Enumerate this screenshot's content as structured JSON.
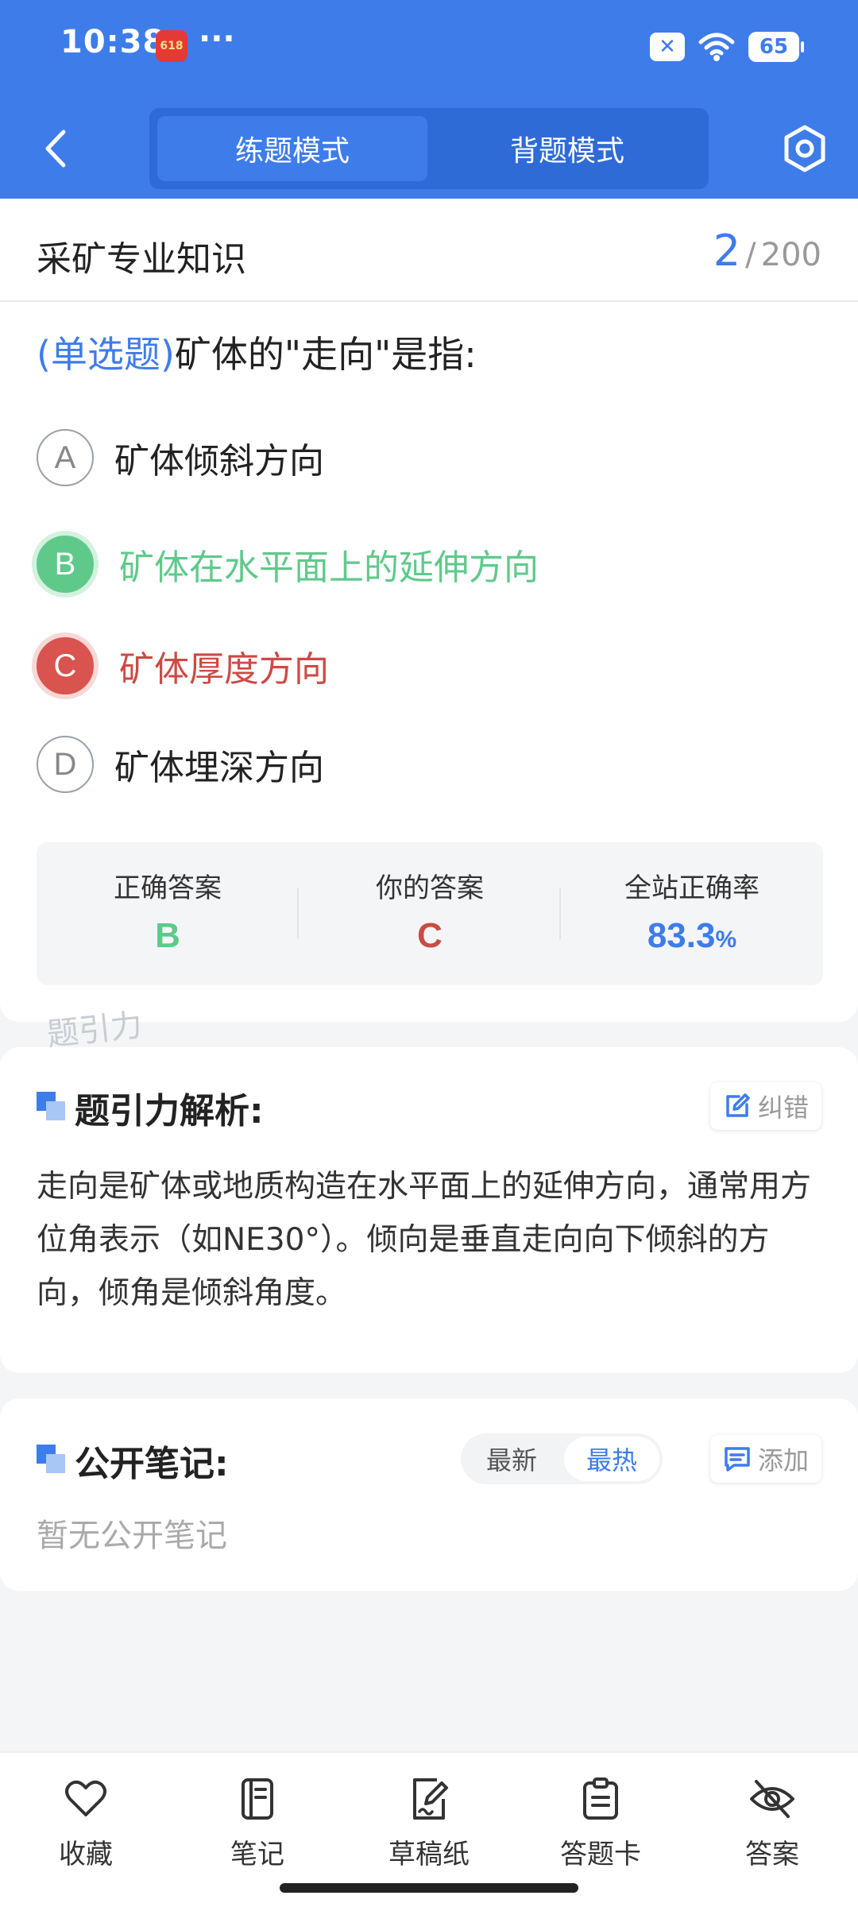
{
  "status_bar": {
    "time": "10:38",
    "badge": "618",
    "more": "···",
    "battery": "65"
  },
  "nav": {
    "tabs": [
      {
        "label": "练题模式",
        "active": true
      },
      {
        "label": "背题模式",
        "active": false
      }
    ],
    "icons": [
      "back-icon",
      "settings-icon"
    ]
  },
  "header": {
    "subject": "采矿专业知识",
    "current": "2",
    "separator": "/",
    "total": "200"
  },
  "question": {
    "type": "(单选题)",
    "text": "矿体的\"走向\"是指:",
    "options": [
      {
        "letter": "A",
        "text": "矿体倾斜方向",
        "state": "normal"
      },
      {
        "letter": "B",
        "text": "矿体在水平面上的延伸方向",
        "state": "correct"
      },
      {
        "letter": "C",
        "text": "矿体厚度方向",
        "state": "wrong"
      },
      {
        "letter": "D",
        "text": "矿体埋深方向",
        "state": "normal"
      }
    ]
  },
  "answers": {
    "correct_label": "正确答案",
    "correct_value": "B",
    "yours_label": "你的答案",
    "yours_value": "C",
    "rate_label": "全站正确率",
    "rate_value": "83.3",
    "rate_unit": "%"
  },
  "watermark": "题引力",
  "analysis": {
    "title": "题引力解析:",
    "report_label": "纠错",
    "text": "走向是矿体或地质构造在水平面上的延伸方向，通常用方位角表示（如NE30°）。倾向是垂直走向向下倾斜的方向，倾角是倾斜角度。"
  },
  "notes": {
    "title": "公开笔记:",
    "sort_latest": "最新",
    "sort_hot": "最热",
    "add_label": "添加",
    "empty": "暂无公开笔记"
  },
  "bottom_tabs": [
    {
      "label": "收藏",
      "icon": "heart-icon"
    },
    {
      "label": "笔记",
      "icon": "notebook-icon"
    },
    {
      "label": "草稿纸",
      "icon": "draft-icon"
    },
    {
      "label": "答题卡",
      "icon": "answer-card-icon"
    },
    {
      "label": "答案",
      "icon": "eye-off-icon"
    }
  ],
  "colors": {
    "primary": "#3E7CEA",
    "correct": "#5FC98A",
    "wrong": "#D9534F"
  }
}
